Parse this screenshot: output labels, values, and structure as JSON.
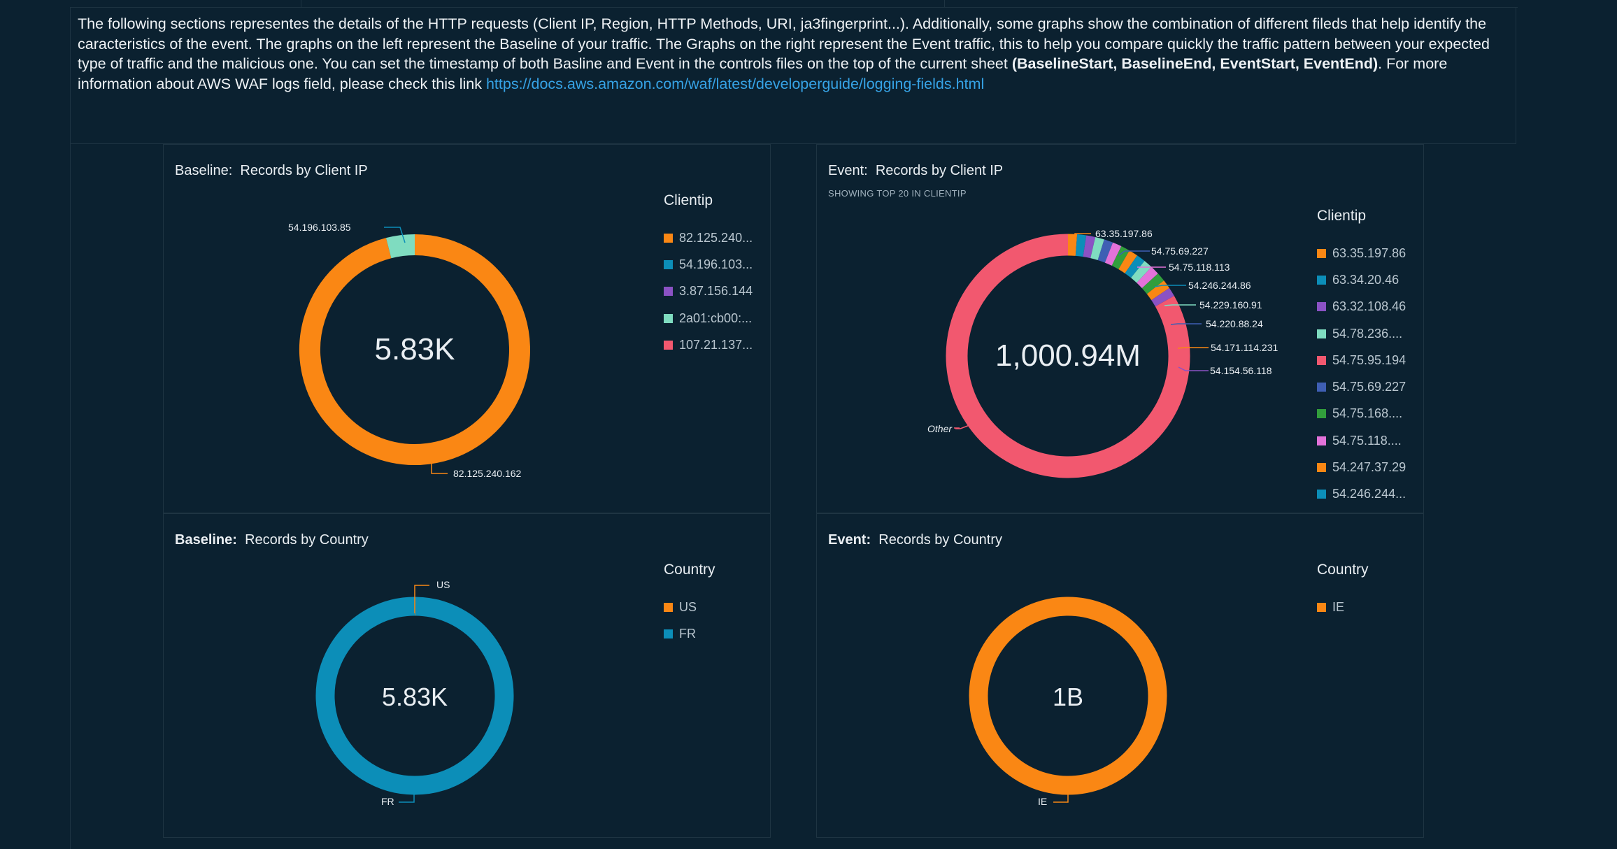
{
  "description": {
    "intro": "The following sections representes the details of the HTTP requests (Client IP, Region, HTTP Methods, URI, ja3fingerprint...). Additionally, some graphs show the combination of different fileds that help identify the caracteristics of the event. The graphs on the left represent the Baseline of your traffic. The Graphs on the right represent the Event traffic, this to help you compare quickly the traffic pattern between your expected type of traffic and the malicious one. You can set the timestamp of both Basline and Event in the controls files on the top of the current sheet ",
    "controls": "(BaselineStart, BaselineEnd, EventStart, EventEnd)",
    "outro": ". For more information about AWS WAF logs field, please check this link ",
    "link": "https://docs.aws.amazon.com/waf/latest/developerguide/logging-fields.html"
  },
  "colors": {
    "background": "#0b2130",
    "orange": "#fa8714",
    "blue": "#0c8eb8",
    "purple": "#8b52c4",
    "mint": "#7fdcc0",
    "pink": "#f2586f",
    "indigo": "#3f5fb4",
    "green": "#329e3c",
    "magenta": "#e372d9",
    "link": "#36a3e6"
  },
  "panels": {
    "baseline_ip": {
      "title_prefix": "Baseline:",
      "title_rest": "Records by Client IP",
      "legend_title": "Clientip",
      "legend": [
        {
          "label": "82.125.240...",
          "color": "#fa8714"
        },
        {
          "label": "54.196.103...",
          "color": "#0c8eb8"
        },
        {
          "label": "3.87.156.144",
          "color": "#8b52c4"
        },
        {
          "label": "2a01:cb00:...",
          "color": "#7fdcc0"
        },
        {
          "label": "107.21.137...",
          "color": "#f2586f"
        }
      ],
      "total": "5.83K",
      "callouts": [
        "54.196.103.85",
        "82.125.240.162"
      ]
    },
    "event_ip": {
      "title_prefix": "Event:",
      "title_rest": "Records by Client IP",
      "subtitle": "SHOWING TOP 20 IN CLIENTIP",
      "legend_title": "Clientip",
      "legend": [
        {
          "label": "63.35.197.86",
          "color": "#fa8714"
        },
        {
          "label": "63.34.20.46",
          "color": "#0c8eb8"
        },
        {
          "label": "63.32.108.46",
          "color": "#8b52c4"
        },
        {
          "label": "54.78.236....",
          "color": "#7fdcc0"
        },
        {
          "label": "54.75.95.194",
          "color": "#f2586f"
        },
        {
          "label": "54.75.69.227",
          "color": "#3f5fb4"
        },
        {
          "label": "54.75.168....",
          "color": "#329e3c"
        },
        {
          "label": "54.75.118....",
          "color": "#e372d9"
        },
        {
          "label": "54.247.37.29",
          "color": "#fa8714"
        },
        {
          "label": "54.246.244...",
          "color": "#0c8eb8"
        }
      ],
      "total": "1,000.94M",
      "callouts": [
        "63.35.197.86",
        "54.75.69.227",
        "54.75.118.113",
        "54.246.244.86",
        "54.229.160.91",
        "54.220.88.24",
        "54.171.114.231",
        "54.154.56.118",
        "Other"
      ]
    },
    "baseline_country": {
      "title_prefix": "Baseline:",
      "title_rest": "Records by Country",
      "legend_title": "Country",
      "legend": [
        {
          "label": "US",
          "color": "#fa8714"
        },
        {
          "label": "FR",
          "color": "#0c8eb8"
        }
      ],
      "total": "5.83K",
      "callouts": [
        "US",
        "FR"
      ]
    },
    "event_country": {
      "title_prefix": "Event:",
      "title_rest": "Records by Country",
      "legend_title": "Country",
      "legend": [
        {
          "label": "IE",
          "color": "#fa8714"
        }
      ],
      "total": "1B",
      "callouts": [
        "IE"
      ]
    }
  },
  "chart_data": [
    {
      "type": "pie",
      "title": "Baseline: Records by Client IP",
      "total": "5.83K",
      "categories": [
        "82.125.240.162",
        "54.196.103.85"
      ],
      "values": [
        96,
        4
      ]
    },
    {
      "type": "pie",
      "title": "Event: Records by Client IP",
      "total": "1,000.94M",
      "categories": [
        "63.35.197.86",
        "63.34.20.46",
        "63.32.108.46",
        "54.78.236....",
        "54.75.95.194",
        "54.75.69.227",
        "54.75.168....",
        "54.75.118.113",
        "54.247.37.29",
        "54.246.244.86",
        "54.229.160.91",
        "54.220.88.24",
        "54.171.114.231",
        "54.154.56.118",
        "Other"
      ],
      "values": [
        1.2,
        1.2,
        1.2,
        1.2,
        1.2,
        1.2,
        1.2,
        1.2,
        1.2,
        1.2,
        1.2,
        1.2,
        1.2,
        1.2,
        83.2
      ]
    },
    {
      "type": "pie",
      "title": "Baseline: Records by Country",
      "total": "5.83K",
      "categories": [
        "US",
        "FR"
      ],
      "values": [
        0.1,
        99.9
      ]
    },
    {
      "type": "pie",
      "title": "Event: Records by Country",
      "total": "1B",
      "categories": [
        "IE"
      ],
      "values": [
        100
      ]
    }
  ]
}
